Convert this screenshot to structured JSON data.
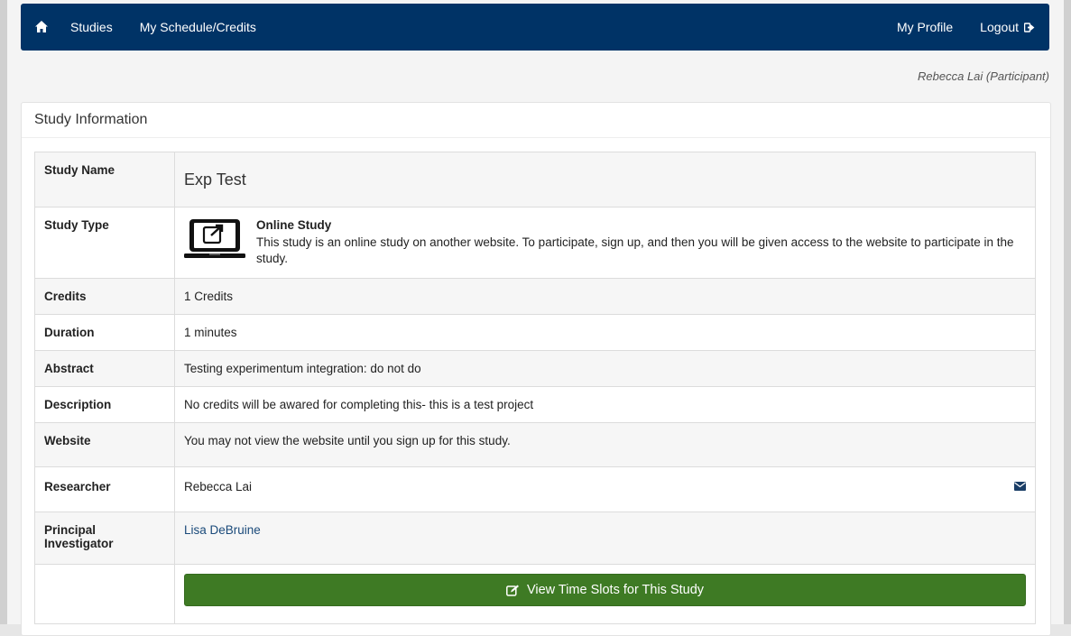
{
  "nav": {
    "home_icon": "home-icon",
    "studies": "Studies",
    "schedule": "My Schedule/Credits",
    "profile": "My Profile",
    "logout": "Logout",
    "logout_icon": "sign-out-icon",
    "bg_color": "#003366"
  },
  "user": {
    "display": "Rebecca Lai (Participant)"
  },
  "panel": {
    "title": "Study Information"
  },
  "rows": {
    "study_name": {
      "label": "Study Name",
      "value": "Exp Test"
    },
    "study_type": {
      "label": "Study Type",
      "icon": "laptop-external-link-icon",
      "title": "Online Study",
      "desc": "This study is an online study on another website. To participate, sign up, and then you will be given access to the website to participate in the study."
    },
    "credits": {
      "label": "Credits",
      "value": "1 Credits"
    },
    "duration": {
      "label": "Duration",
      "value": "1 minutes"
    },
    "abstract": {
      "label": "Abstract",
      "value": "Testing experimentum integration: do not do"
    },
    "description": {
      "label": "Description",
      "value": "No credits will be awared for completing this- this is a test project"
    },
    "website": {
      "label": "Website",
      "value": "You may not view the website until you sign up for this study."
    },
    "researcher": {
      "label": "Researcher",
      "value": "Rebecca Lai",
      "icon": "envelope-icon"
    },
    "pi": {
      "label": "Principal Investigator",
      "value": "Lisa DeBruine"
    }
  },
  "action": {
    "label": "View Time Slots for This Study",
    "icon": "edit-icon",
    "color": "#3e7a24"
  }
}
